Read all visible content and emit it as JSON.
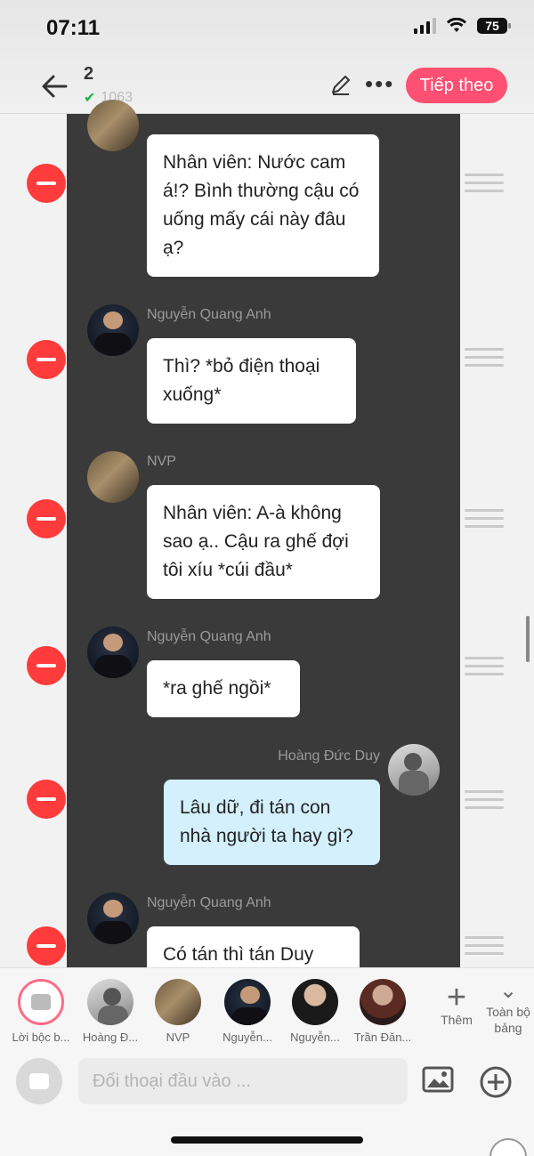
{
  "status_bar": {
    "time": "07:11",
    "battery": "75"
  },
  "header": {
    "title": "2",
    "subtitle_count": "1063",
    "next_label": "Tiếp theo"
  },
  "messages": [
    {
      "sender": "NVP",
      "text": "Nhân viên: Nước cam á!? Bình thường cậu có uống mấy cái này đâu ạ?"
    },
    {
      "sender": "Nguyễn Quang Anh",
      "text": "Thì? *bỏ điện thoại xuống*"
    },
    {
      "sender": "NVP",
      "text": "Nhân viên: A-à không sao ạ.. Cậu ra ghế đợi tôi xíu *cúi đầu*"
    },
    {
      "sender": "Nguyễn Quang Anh",
      "text": "*ra ghế ngồi*"
    },
    {
      "sender": "Hoàng Đức Duy",
      "text": "Lâu dữ, đi tán con nhà người ta hay gì?"
    },
    {
      "sender": "Nguyễn Quang Anh",
      "text": "Có tán thì tán Duy"
    }
  ],
  "characters": [
    {
      "label": "Lời bộc b..."
    },
    {
      "label": "Hoàng Đ..."
    },
    {
      "label": "NVP"
    },
    {
      "label": "Nguyễn..."
    },
    {
      "label": "Nguyễn..."
    },
    {
      "label": "Trần Đăn..."
    }
  ],
  "add_character_label": "Thêm",
  "full_board_label": "Toàn bộ bảng",
  "input": {
    "placeholder": "Đối thoại đầu vào ..."
  }
}
